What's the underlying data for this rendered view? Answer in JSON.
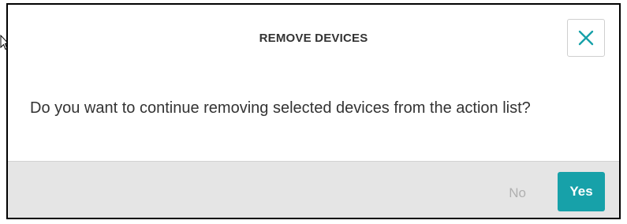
{
  "dialog": {
    "title": "REMOVE DEVICES",
    "message": "Do you want to continue removing selected devices from the action list?",
    "close_icon": "close-icon"
  },
  "footer": {
    "no_label": "No",
    "yes_label": "Yes"
  },
  "colors": {
    "accent": "#17a1a9",
    "footer_bg": "#e5e5e5",
    "muted_text": "#b0b0b0",
    "text": "#333333"
  }
}
